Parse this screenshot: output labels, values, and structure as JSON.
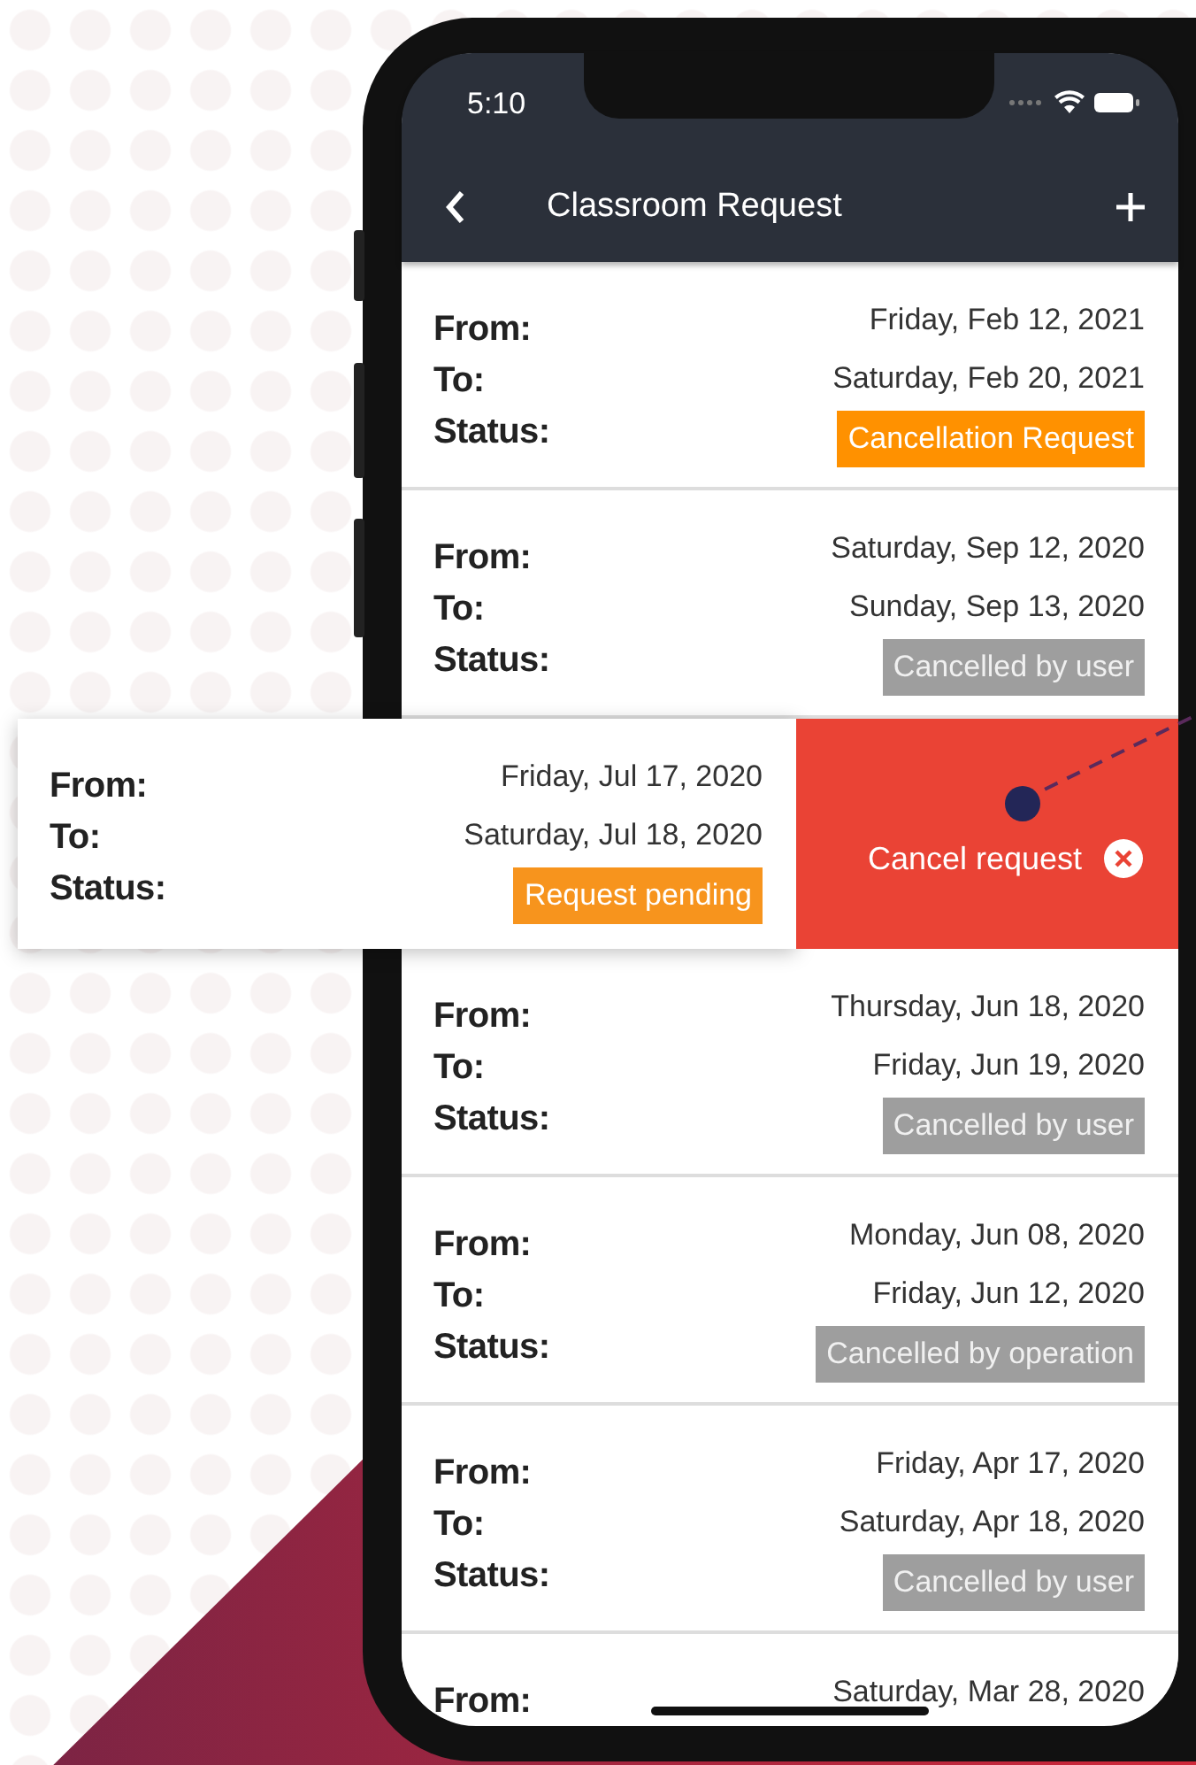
{
  "status_bar": {
    "time": "5:10"
  },
  "header": {
    "title": "Classroom Request"
  },
  "requests": [
    {
      "labels": [
        "From:",
        "To:",
        "Status:"
      ],
      "from": "Friday, Feb 12, 2021",
      "to": "Saturday, Feb 20, 2021",
      "status": {
        "text": "Cancellation Request",
        "color": "#ff9100"
      },
      "swiped": false
    },
    {
      "labels": [
        "From:",
        "To:",
        "Status:"
      ],
      "from": "Saturday, Sep 12, 2020",
      "to": "Sunday, Sep 13, 2020",
      "status": {
        "text": "Cancelled by user",
        "color": "#9e9e9e"
      },
      "swiped": false
    },
    {
      "labels": [
        "From:",
        "To:",
        "Status:"
      ],
      "from": "Friday, Jul 17, 2020",
      "to": "Saturday, Jul 18, 2020",
      "status": {
        "text": "Request pending",
        "color": "#f7941d"
      },
      "swiped": true,
      "action": "Cancel request"
    },
    {
      "labels": [
        "From:",
        "To:",
        "Status:"
      ],
      "from": "Thursday, Jun 18, 2020",
      "to": "Friday, Jun 19, 2020",
      "status": {
        "text": "Cancelled by user",
        "color": "#9e9e9e"
      },
      "swiped": false
    },
    {
      "labels": [
        "From:",
        "To:",
        "Status:"
      ],
      "from": "Monday, Jun 08, 2020",
      "to": "Friday, Jun 12, 2020",
      "status": {
        "text": "Cancelled by operation",
        "color": "#9e9e9e"
      },
      "swiped": false
    },
    {
      "labels": [
        "From:",
        "To:",
        "Status:"
      ],
      "from": "Friday, Apr 17, 2020",
      "to": "Saturday, Apr 18, 2020",
      "status": {
        "text": "Cancelled by user",
        "color": "#9e9e9e"
      },
      "swiped": false
    },
    {
      "labels": [
        "From:"
      ],
      "from": "Saturday, Mar 28, 2020",
      "swiped": false
    }
  ]
}
